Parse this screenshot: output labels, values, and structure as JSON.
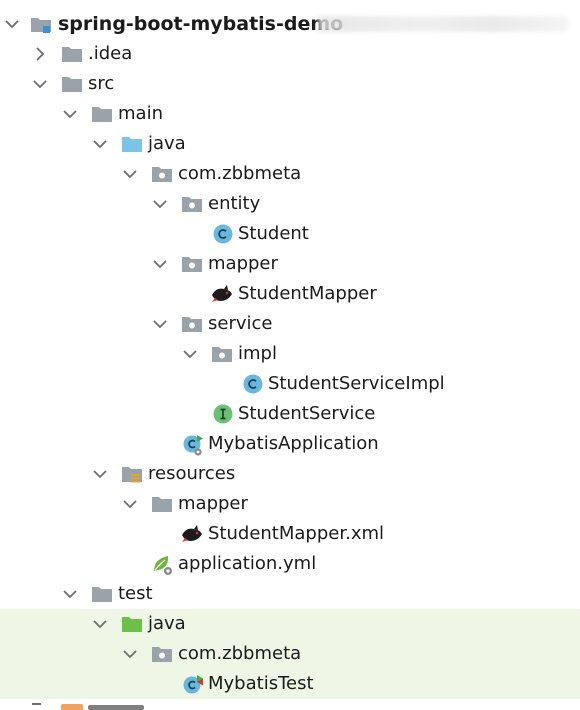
{
  "project_tree": {
    "root": {
      "label": "spring-boot-mybatis-demo"
    },
    "idea": {
      "label": ".idea"
    },
    "src": {
      "label": "src"
    },
    "main": {
      "label": "main"
    },
    "main_java": {
      "label": "java"
    },
    "pkg_main": {
      "label": "com.zbbmeta"
    },
    "entity": {
      "label": "entity"
    },
    "student": {
      "label": "Student"
    },
    "mapper_pkg": {
      "label": "mapper"
    },
    "student_mapper": {
      "label": "StudentMapper"
    },
    "service": {
      "label": "service"
    },
    "impl": {
      "label": "impl"
    },
    "service_impl": {
      "label": "StudentServiceImpl"
    },
    "student_service": {
      "label": "StudentService"
    },
    "mybatis_app": {
      "label": "MybatisApplication"
    },
    "resources": {
      "label": "resources"
    },
    "res_mapper": {
      "label": "mapper"
    },
    "mapper_xml": {
      "label": "StudentMapper.xml"
    },
    "app_yml": {
      "label": "application.yml"
    },
    "test": {
      "label": "test"
    },
    "test_java": {
      "label": "java"
    },
    "pkg_test": {
      "label": "com.zbbmeta"
    },
    "mybatis_test": {
      "label": "MybatisTest"
    }
  },
  "colors": {
    "folder_gray": "#9aa3aa",
    "folder_source_blue": "#7cc3e6",
    "folder_test_green": "#6cc04a",
    "class_blue": "#6ab7dd",
    "interface_green": "#6bbf76",
    "test_row_bg": "#eef7e6",
    "arrow": "#6e6e6e"
  }
}
